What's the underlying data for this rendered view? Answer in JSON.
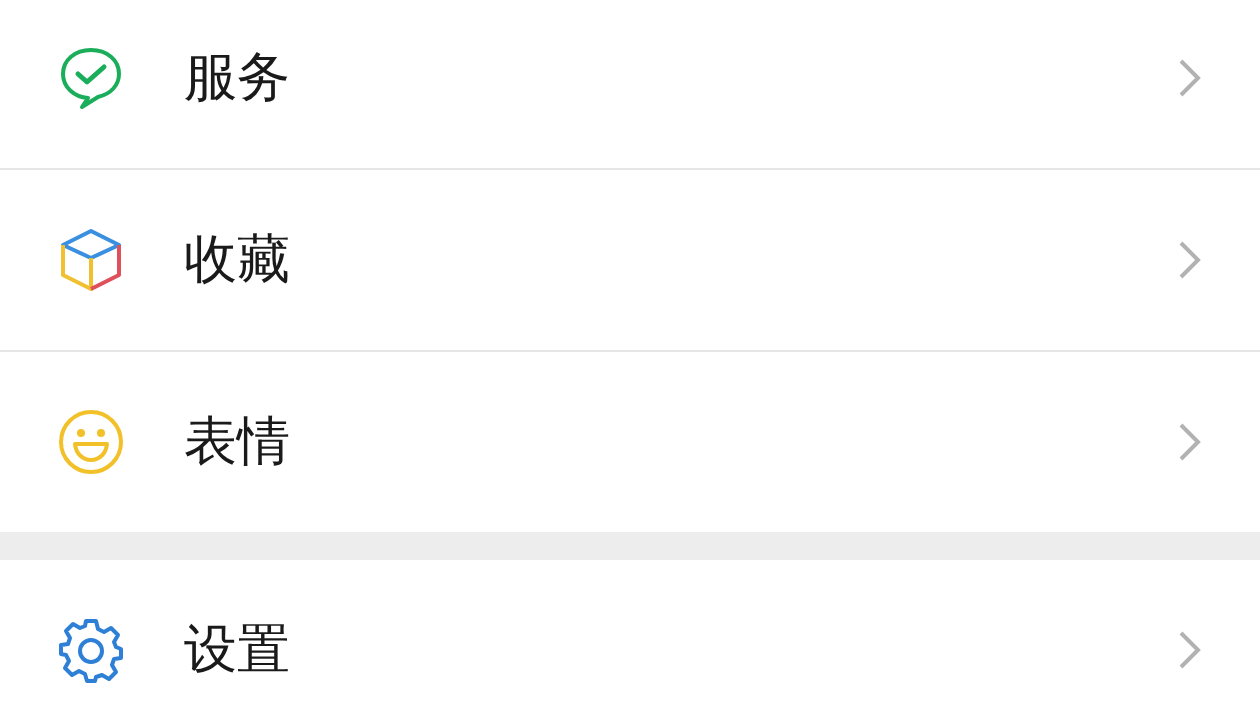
{
  "groups": [
    {
      "items": [
        {
          "label": "服务",
          "kind": "chat"
        },
        {
          "label": "收藏",
          "kind": "cube"
        },
        {
          "label": "表情",
          "kind": "smile"
        }
      ]
    },
    {
      "items": [
        {
          "label": "设置",
          "kind": "gear"
        }
      ]
    }
  ]
}
